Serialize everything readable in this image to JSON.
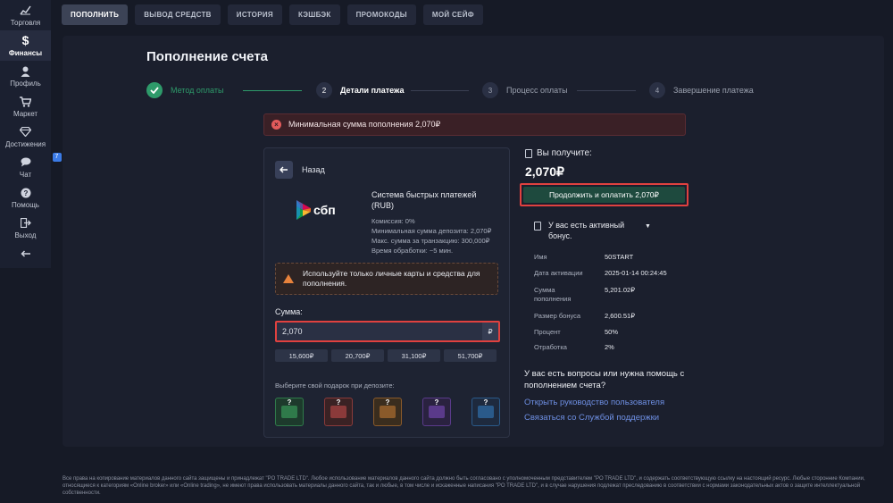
{
  "sidebar": {
    "items": [
      {
        "label": "Торговля",
        "icon": "chart-icon"
      },
      {
        "label": "Финансы",
        "icon": "dollar-icon"
      },
      {
        "label": "Профиль",
        "icon": "user-icon"
      },
      {
        "label": "Маркет",
        "icon": "cart-icon"
      },
      {
        "label": "Достижения",
        "icon": "diamond-icon"
      },
      {
        "label": "Чат",
        "icon": "chat-icon",
        "badge": "7"
      },
      {
        "label": "Помощь",
        "icon": "help-icon"
      },
      {
        "label": "Выход",
        "icon": "logout-icon"
      }
    ],
    "collapse_icon": "arrow-left-icon"
  },
  "tabs": [
    {
      "label": "ПОПОЛНИТЬ",
      "active": true
    },
    {
      "label": "ВЫВОД СРЕДСТВ"
    },
    {
      "label": "ИСТОРИЯ"
    },
    {
      "label": "КЭШБЭК"
    },
    {
      "label": "ПРОМОКОДЫ"
    },
    {
      "label": "МОЙ СЕЙФ"
    }
  ],
  "page": {
    "title": "Пополнение счета"
  },
  "steps": [
    {
      "num": "",
      "label": "Метод оплаты",
      "state": "done"
    },
    {
      "num": "2",
      "label": "Детали платежа",
      "state": "active"
    },
    {
      "num": "3",
      "label": "Процесс оплаты",
      "state": "pending"
    },
    {
      "num": "4",
      "label": "Завершение платежа",
      "state": "pending"
    }
  ],
  "error": {
    "text": "Минимальная сумма пополнения 2,070₽"
  },
  "payment": {
    "back_label": "Назад",
    "logo_text": "сбп",
    "method_title": "Система быстрых платежей (RUB)",
    "details": [
      "Комиссия: 0%",
      "Минимальная сумма депозита: 2,070₽",
      "Макс. сумма за транзакцию: 300,000₽",
      "Время обработки: ~5 мин."
    ],
    "warning": "Используйте только личные карты и средства для пополнения.",
    "sum_label": "Сумма:",
    "sum_value": "2,070",
    "currency": "₽",
    "presets": [
      "15,600₽",
      "20,700₽",
      "31,100₽",
      "51,700₽"
    ],
    "gift_label": "Выберите свой подарок при депозите:",
    "gift_colors": [
      "#2f7a4a",
      "#8a3a3a",
      "#8a5a2a",
      "#5a3a8a",
      "#2a5a8a"
    ]
  },
  "summary": {
    "receive_label": "Вы получите:",
    "receive_amount": "2,070₽",
    "pay_button": "Продолжить и оплатить 2,070₽",
    "bonus_text": "У вас есть активный бонус.",
    "bonus": [
      {
        "key": "Имя",
        "value": "50START"
      },
      {
        "key": "Дата активации",
        "value": "2025-01-14 00:24:45"
      },
      {
        "key": "Сумма пополнения",
        "value": "5,201.02₽"
      },
      {
        "key": "Размер бонуса",
        "value": "2,600.51₽"
      },
      {
        "key": "Процент",
        "value": "50%"
      },
      {
        "key": "Отработка",
        "value": "2%"
      }
    ],
    "help_question": "У вас есть вопросы или нужна помощь с пополнением счета?",
    "link_guide": "Открыть руководство пользователя",
    "link_support": "Связаться со Службой поддержки"
  },
  "footer": {
    "text": "Все права на копирование материалов данного сайта защищены и принадлежат \"PO TRADE LTD\". Любое использование материалов данного сайта должно быть согласовано с уполномоченным представителем \"PO TRADE LTD\", и содержать соответствующую ссылку на настоящий ресурс. Любые сторонние Компании, относящиеся к категориям «Online broker» или «Online trading», не имеют права использовать материалы данного сайта, так и любые, в том числе и искаженные написания \"PO TRADE LTD\", и в случае нарушения подлежат преследованию в соответствии с нормами законодательных актов о защите интеллектуальной собственности."
  },
  "colors": {
    "accent_green": "#2e9a6a",
    "error_red": "#e0413f",
    "link_blue": "#6e8fe3"
  }
}
